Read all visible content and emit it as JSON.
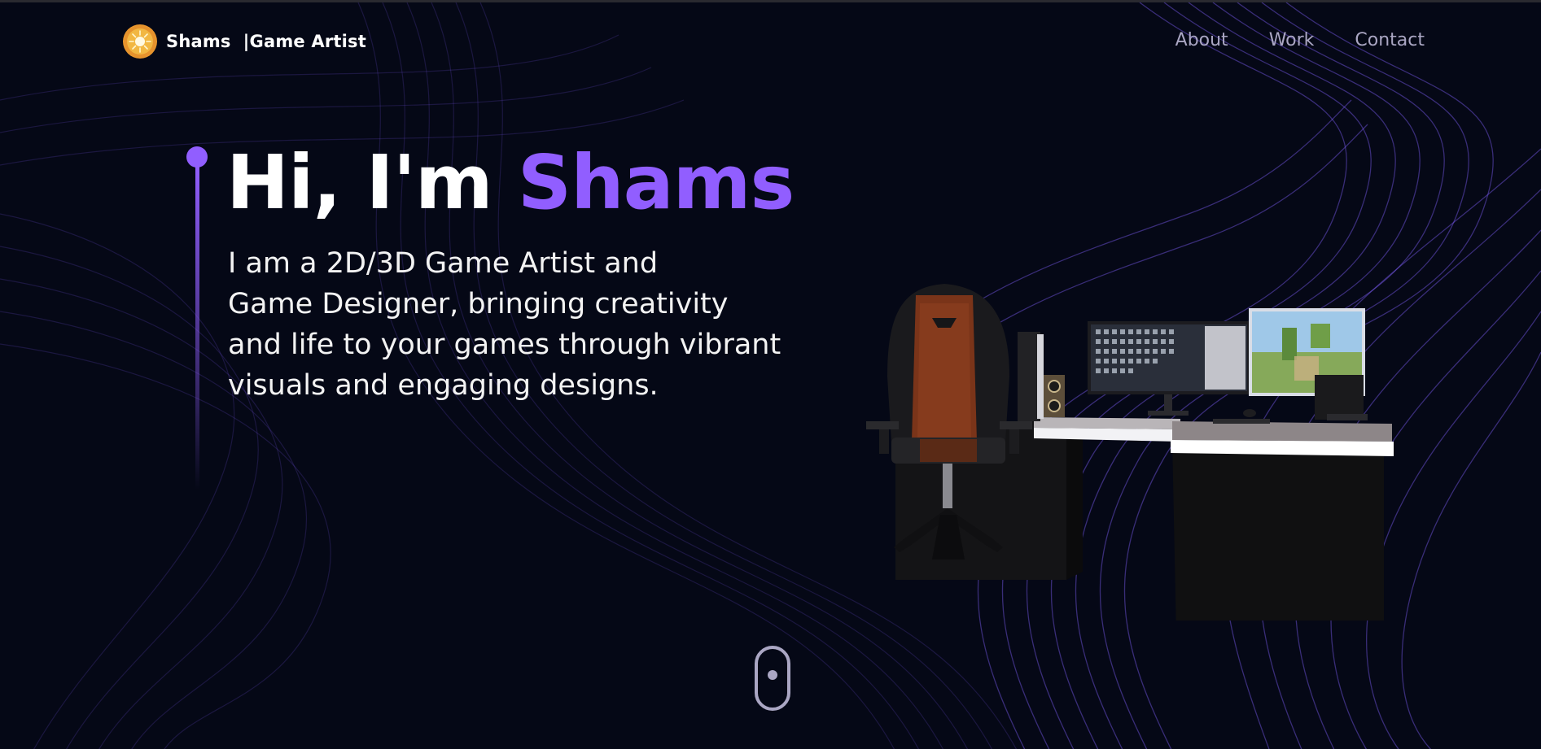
{
  "nav": {
    "logo_icon": "sun-icon",
    "brand_name": "Shams",
    "brand_role": "|Game Artist",
    "links": [
      "About",
      "Work",
      "Contact"
    ]
  },
  "hero": {
    "greeting": "Hi, I'm ",
    "name": "Shams",
    "subtitle_lines": [
      "I am a 2D/3D Game Artist and",
      "Game Designer, bringing creativity",
      "and life to your games through vibrant",
      "visuals and engaging designs."
    ]
  },
  "scroll_indicator": {
    "icon": "mouse-scroll-icon"
  },
  "colors": {
    "background": "#050816",
    "accent": "#915eff",
    "nav_text": "#aaa6c3",
    "text": "#ffffff"
  }
}
